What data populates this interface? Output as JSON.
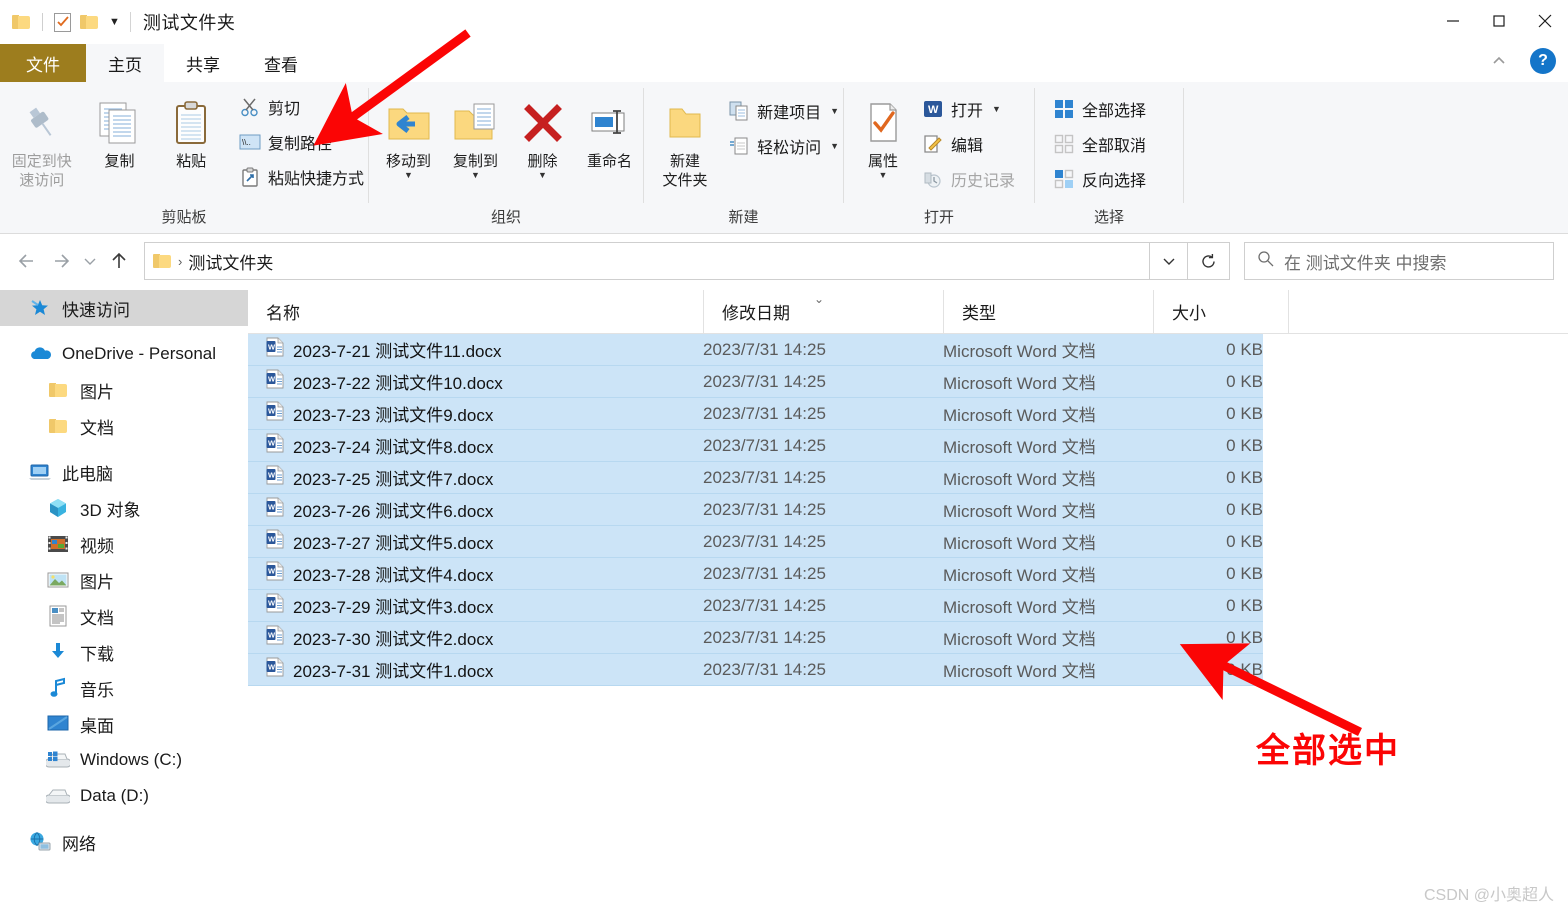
{
  "window": {
    "title": "测试文件夹",
    "quick_access": [
      "folder-icon",
      "doc-check-icon",
      "folder-icon"
    ],
    "controls": {
      "minimize": "minimize-icon",
      "maximize": "maximize-icon",
      "close": "close-icon"
    },
    "help": "?"
  },
  "tabs": [
    {
      "label": "文件",
      "kind": "file"
    },
    {
      "label": "主页",
      "kind": "active"
    },
    {
      "label": "共享",
      "kind": "normal"
    },
    {
      "label": "查看",
      "kind": "normal"
    }
  ],
  "ribbon": {
    "groups": [
      {
        "label": "剪贴板",
        "big": [
          {
            "label": "固定到快\n速访问",
            "line1": "固定到快",
            "line2": "速访问",
            "icon": "pin-icon",
            "disabled": true
          },
          {
            "label": "复制",
            "line1": "复制",
            "line2": "",
            "icon": "copy-icon",
            "disabled": false
          },
          {
            "label": "粘贴",
            "line1": "粘贴",
            "line2": "",
            "icon": "paste-icon",
            "disabled": false
          }
        ],
        "small": [
          {
            "label": "剪切",
            "icon": "scissors-icon",
            "caret": false,
            "disabled": false
          },
          {
            "label": "复制路径",
            "icon": "copy-path-icon",
            "caret": false,
            "disabled": false
          },
          {
            "label": "粘贴快捷方式",
            "icon": "paste-shortcut-icon",
            "caret": false,
            "disabled": false
          }
        ]
      },
      {
        "label": "组织",
        "big": [
          {
            "line1": "移动到",
            "line2": "",
            "icon": "move-to-icon",
            "caret": true,
            "disabled": false
          },
          {
            "line1": "复制到",
            "line2": "",
            "icon": "copy-to-icon",
            "caret": true,
            "disabled": false
          },
          {
            "line1": "删除",
            "line2": "",
            "icon": "delete-icon",
            "caret": true,
            "disabled": false
          },
          {
            "line1": "重命名",
            "line2": "",
            "icon": "rename-icon",
            "caret": false,
            "disabled": false
          }
        ],
        "small": []
      },
      {
        "label": "新建",
        "big": [
          {
            "line1": "新建",
            "line2": "文件夹",
            "icon": "new-folder-icon",
            "caret": false,
            "disabled": false
          }
        ],
        "small": [
          {
            "label": "新建项目",
            "icon": "new-item-icon",
            "caret": true,
            "disabled": false
          },
          {
            "label": "轻松访问",
            "icon": "easy-access-icon",
            "caret": true,
            "disabled": false
          }
        ]
      },
      {
        "label": "打开",
        "big": [
          {
            "line1": "属性",
            "line2": "",
            "icon": "properties-icon",
            "caret": true,
            "disabled": false
          }
        ],
        "small": [
          {
            "label": "打开",
            "icon": "word-open-icon",
            "caret": true,
            "disabled": false
          },
          {
            "label": "编辑",
            "icon": "edit-icon",
            "caret": false,
            "disabled": false
          },
          {
            "label": "历史记录",
            "icon": "history-icon",
            "caret": false,
            "disabled": true
          }
        ]
      },
      {
        "label": "选择",
        "big": [],
        "small": [
          {
            "label": "全部选择",
            "icon": "select-all-icon",
            "caret": false,
            "disabled": false
          },
          {
            "label": "全部取消",
            "icon": "select-none-icon",
            "caret": false,
            "disabled": false
          },
          {
            "label": "反向选择",
            "icon": "invert-selection-icon",
            "caret": false,
            "disabled": false
          }
        ]
      }
    ]
  },
  "address": {
    "back": "back-arrow-icon",
    "forward": "forward-arrow-icon",
    "recent": "chevron-down-icon",
    "up": "up-arrow-icon",
    "crumb_icon": "folder-icon",
    "crumb_sep": "›",
    "path": "测试文件夹",
    "dropdown": "chevron-down-icon",
    "refresh": "refresh-icon"
  },
  "search": {
    "icon": "search-icon",
    "placeholder": "在 测试文件夹 中搜索"
  },
  "sidebar": {
    "items": [
      {
        "label": "快速访问",
        "icon": "pin-star-icon",
        "level": 0,
        "selected": true
      },
      {
        "gap": true
      },
      {
        "label": "OneDrive - Personal",
        "icon": "onedrive-icon",
        "level": 0,
        "selected": false
      },
      {
        "label": "图片",
        "icon": "folder-icon",
        "level": 1,
        "selected": false
      },
      {
        "label": "文档",
        "icon": "folder-icon",
        "level": 1,
        "selected": false
      },
      {
        "gap": true
      },
      {
        "label": "此电脑",
        "icon": "this-pc-icon",
        "level": 0,
        "selected": false
      },
      {
        "label": "3D 对象",
        "icon": "3d-objects-icon",
        "level": 1,
        "selected": false
      },
      {
        "label": "视频",
        "icon": "videos-icon",
        "level": 1,
        "selected": false
      },
      {
        "label": "图片",
        "icon": "pictures-icon",
        "level": 1,
        "selected": false
      },
      {
        "label": "文档",
        "icon": "documents-icon",
        "level": 1,
        "selected": false
      },
      {
        "label": "下载",
        "icon": "downloads-icon",
        "level": 1,
        "selected": false
      },
      {
        "label": "音乐",
        "icon": "music-icon",
        "level": 1,
        "selected": false
      },
      {
        "label": "桌面",
        "icon": "desktop-icon",
        "level": 1,
        "selected": false
      },
      {
        "label": "Windows (C:)",
        "icon": "windows-drive-icon",
        "level": 1,
        "selected": false
      },
      {
        "label": "Data (D:)",
        "icon": "drive-icon",
        "level": 1,
        "selected": false
      },
      {
        "gap": true
      },
      {
        "label": "网络",
        "icon": "network-icon",
        "level": 0,
        "selected": false
      }
    ]
  },
  "filelist": {
    "columns": [
      {
        "label": "名称",
        "key": "name"
      },
      {
        "label": "修改日期",
        "key": "date",
        "sorted": true
      },
      {
        "label": "类型",
        "key": "type"
      },
      {
        "label": "大小",
        "key": "size"
      }
    ],
    "sort_indicator": "⌄",
    "rows": [
      {
        "name": "2023-7-21 测试文件11.docx",
        "date": "2023/7/31 14:25",
        "type": "Microsoft Word 文档",
        "size": "0 KB",
        "icon": "word-file-icon",
        "selected": true
      },
      {
        "name": "2023-7-22 测试文件10.docx",
        "date": "2023/7/31 14:25",
        "type": "Microsoft Word 文档",
        "size": "0 KB",
        "icon": "word-file-icon",
        "selected": true
      },
      {
        "name": "2023-7-23 测试文件9.docx",
        "date": "2023/7/31 14:25",
        "type": "Microsoft Word 文档",
        "size": "0 KB",
        "icon": "word-file-icon",
        "selected": true
      },
      {
        "name": "2023-7-24 测试文件8.docx",
        "date": "2023/7/31 14:25",
        "type": "Microsoft Word 文档",
        "size": "0 KB",
        "icon": "word-file-icon",
        "selected": true
      },
      {
        "name": "2023-7-25 测试文件7.docx",
        "date": "2023/7/31 14:25",
        "type": "Microsoft Word 文档",
        "size": "0 KB",
        "icon": "word-file-icon",
        "selected": true
      },
      {
        "name": "2023-7-26 测试文件6.docx",
        "date": "2023/7/31 14:25",
        "type": "Microsoft Word 文档",
        "size": "0 KB",
        "icon": "word-file-icon",
        "selected": true
      },
      {
        "name": "2023-7-27 测试文件5.docx",
        "date": "2023/7/31 14:25",
        "type": "Microsoft Word 文档",
        "size": "0 KB",
        "icon": "word-file-icon",
        "selected": true
      },
      {
        "name": "2023-7-28 测试文件4.docx",
        "date": "2023/7/31 14:25",
        "type": "Microsoft Word 文档",
        "size": "0 KB",
        "icon": "word-file-icon",
        "selected": true
      },
      {
        "name": "2023-7-29 测试文件3.docx",
        "date": "2023/7/31 14:25",
        "type": "Microsoft Word 文档",
        "size": "0 KB",
        "icon": "word-file-icon",
        "selected": true
      },
      {
        "name": "2023-7-30 测试文件2.docx",
        "date": "2023/7/31 14:25",
        "type": "Microsoft Word 文档",
        "size": "0 KB",
        "icon": "word-file-icon",
        "selected": true
      },
      {
        "name": "2023-7-31 测试文件1.docx",
        "date": "2023/7/31 14:25",
        "type": "Microsoft Word 文档",
        "size": "0 KB",
        "icon": "word-file-icon",
        "selected": true
      }
    ]
  },
  "annotations": {
    "color": "#fb0505",
    "arrow_to_copy_path": "arrow-icon",
    "arrow_to_selection": "arrow-icon",
    "caption": "全部选中"
  },
  "watermark": "CSDN @小奥超人"
}
